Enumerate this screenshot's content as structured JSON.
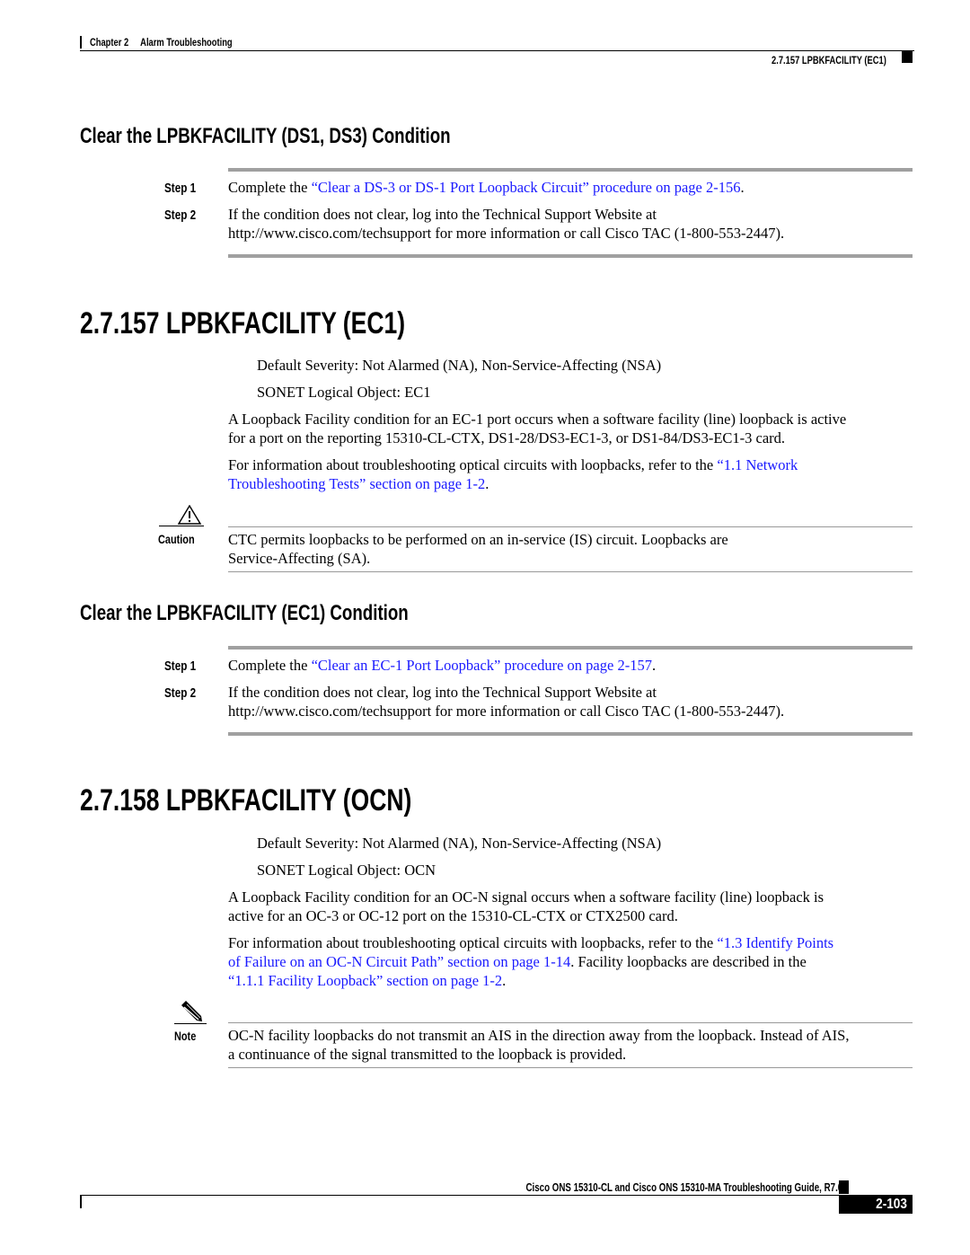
{
  "header": {
    "chapter": "Chapter 2",
    "chapter_title": "Alarm Troubleshooting",
    "section": "2.7.157   LPBKFACILITY (EC1)"
  },
  "clear_ds1_ds3": {
    "title": "Clear the LPBKFACILITY (DS1, DS3) Condition",
    "steps": [
      {
        "label": "Step 1",
        "text_before": "Complete the ",
        "link": "“Clear a DS-3 or DS-1 Port Loopback Circuit” procedure on page 2-156",
        "text_after": "."
      },
      {
        "label": "Step 2",
        "line1": "If the condition does not clear, log into the Technical Support Website at",
        "line2": "http://www.cisco.com/techsupport for more information or call Cisco TAC (1-800-553-2447)."
      }
    ]
  },
  "section_157": {
    "heading": "2.7.157  LPBKFACILITY (EC1)",
    "severity": "Default Severity: Not Alarmed (NA), Non-Service-Affecting (NSA)",
    "logical_object": "SONET Logical Object: EC1",
    "description_line1": "A Loopback Facility condition for an EC-1 port occurs when a software facility (line) loopback is active",
    "description_line2": "for a port on the reporting 15310-CL-CTX, DS1-28/DS3-EC1-3, or DS1-84/DS3-EC1-3 card.",
    "info_before": "For information about troubleshooting optical circuits with loopbacks, refer to the ",
    "info_link_line1": "“1.1  Network",
    "info_link_line2": "Troubleshooting Tests” section on page 1-2",
    "info_after": ".",
    "caution": {
      "label": "Caution",
      "line1": "CTC permits loopbacks to be performed on an in-service (IS) circuit. Loopbacks are",
      "line2": "Service-Affecting (SA)."
    }
  },
  "clear_ec1": {
    "title": "Clear the LPBKFACILITY (EC1) Condition",
    "steps": [
      {
        "label": "Step 1",
        "text_before": "Complete the ",
        "link": "“Clear an EC-1 Port Loopback” procedure on page 2-157",
        "text_after": "."
      },
      {
        "label": "Step 2",
        "line1": "If the condition does not clear, log into the Technical Support Website at",
        "line2": "http://www.cisco.com/techsupport for more information or call Cisco TAC (1-800-553-2447)."
      }
    ]
  },
  "section_158": {
    "heading": "2.7.158  LPBKFACILITY (OCN)",
    "severity": "Default Severity: Not Alarmed (NA), Non-Service-Affecting (NSA)",
    "logical_object": "SONET Logical Object: OCN",
    "description_line1": "A Loopback Facility condition for an OC-N signal occurs when a software facility (line) loopback is",
    "description_line2": "active for an OC-3 or OC-12 port on the 15310-CL-CTX or CTX2500 card.",
    "info_before": "For information about troubleshooting optical circuits with loopbacks, refer to the ",
    "info_link1_line1": "“1.3  Identify Points",
    "info_link1_line2": "of Failure on an OC-N Circuit Path” section on page 1-14",
    "info_middle": ". Facility loopbacks are described in the",
    "info_link2": "“1.1.1  Facility Loopback” section on page 1-2",
    "info_after": ".",
    "note": {
      "label": "Note",
      "line1": "OC-N facility loopbacks do not transmit an AIS in the direction away from the loopback. Instead of AIS,",
      "line2": "a continuance of the signal transmitted to the loopback is provided."
    }
  },
  "footer": {
    "guide_title": "Cisco ONS 15310-CL and Cisco ONS 15310-MA Troubleshooting Guide, R7.0",
    "page_number": "2-103"
  },
  "colors": {
    "link": "#1a1aff",
    "rule_gray": "#a0a0a0"
  }
}
